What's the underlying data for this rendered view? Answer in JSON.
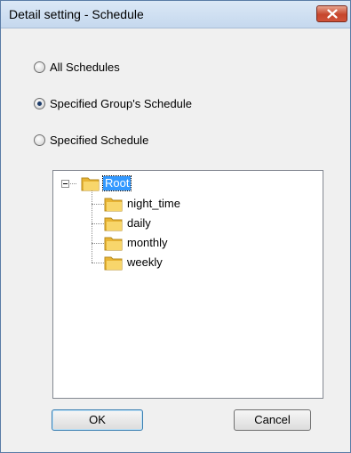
{
  "window": {
    "title": "Detail setting - Schedule"
  },
  "options": [
    {
      "label": "All Schedules",
      "checked": false
    },
    {
      "label": "Specified Group's Schedule",
      "checked": true
    },
    {
      "label": "Specified Schedule",
      "checked": false
    }
  ],
  "tree": {
    "root": {
      "label": "Root",
      "icon": "folder-icon",
      "expanded": true,
      "selected": true
    },
    "children": [
      {
        "label": "night_time",
        "icon": "folder-icon"
      },
      {
        "label": "daily",
        "icon": "folder-icon"
      },
      {
        "label": "monthly",
        "icon": "folder-icon"
      },
      {
        "label": "weekly",
        "icon": "folder-icon"
      }
    ]
  },
  "buttons": {
    "ok": "OK",
    "cancel": "Cancel"
  },
  "colors": {
    "selection": "#3399ff",
    "folder": "#f2c44f",
    "close_button": "#c6452c"
  }
}
